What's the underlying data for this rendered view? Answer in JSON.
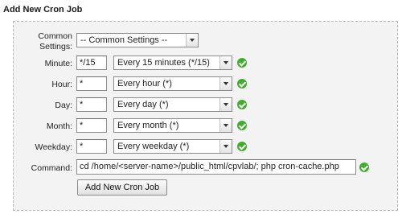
{
  "title": "Add New Cron Job",
  "common": {
    "label_line1": "Common",
    "label_line2": "Settings:",
    "selected": "-- Common Settings --"
  },
  "rows": [
    {
      "label": "Minute:",
      "value": "*/15",
      "selected": "Every 15 minutes (*/15)"
    },
    {
      "label": "Hour:",
      "value": "*",
      "selected": "Every hour (*)"
    },
    {
      "label": "Day:",
      "value": "*",
      "selected": "Every day (*)"
    },
    {
      "label": "Month:",
      "value": "*",
      "selected": "Every month (*)"
    },
    {
      "label": "Weekday:",
      "value": "*",
      "selected": "Every weekday (*)"
    }
  ],
  "command": {
    "label": "Command:",
    "value": "cd /home/<server-name>/public_html/cpvlab/; php cron-cache.php"
  },
  "submit_label": "Add New Cron Job",
  "colors": {
    "panel_bg": "#f3f3f3",
    "valid_check": "#3fae2a"
  },
  "icons": {
    "valid": "check-circle-icon",
    "dropdown": "chevron-down-icon"
  }
}
